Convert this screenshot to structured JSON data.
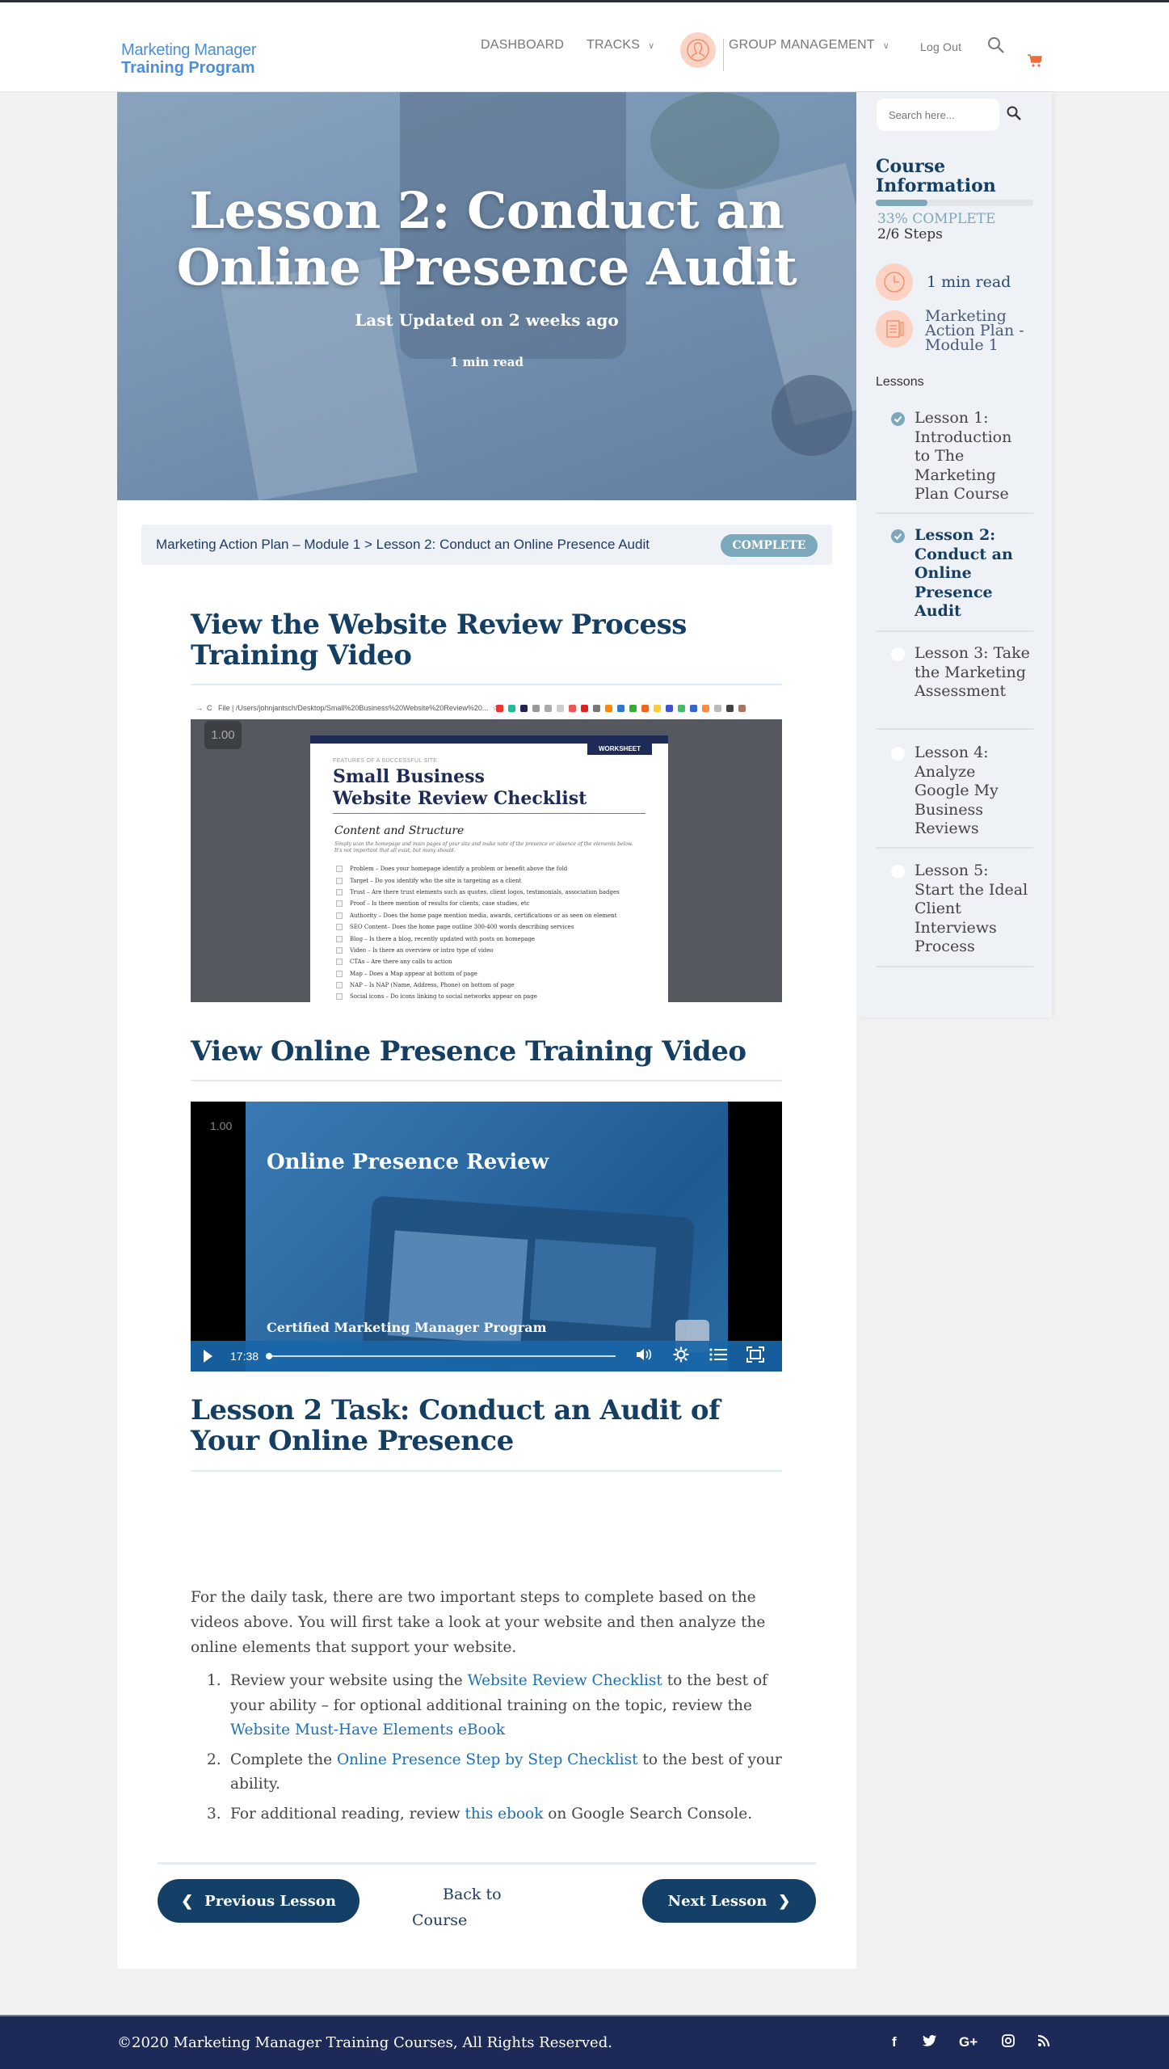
{
  "header": {
    "logo_line1": "Marketing Manager",
    "logo_line2": "Training Program",
    "nav": [
      {
        "label": "DASHBOARD"
      },
      {
        "label": "TRACKS"
      },
      {
        "label": "GROUP MANAGEMENT"
      },
      {
        "label": "Log Out"
      }
    ],
    "chevron": "⌄",
    "icons": {
      "user": "user-avatar-icon",
      "search": "search-icon",
      "cart": "cart-icon"
    },
    "accent_color": "#f06a3c"
  },
  "hero": {
    "title": "Lesson 2: Conduct an Online Presence Audit",
    "updated": "Last Updated on 2 weeks ago",
    "read_time": "1 min read"
  },
  "breadcrumb": {
    "text": "Marketing Action Plan – Module 1 > Lesson 2: Conduct an Online Presence Audit",
    "status": "COMPLETE"
  },
  "sections": {
    "video1_title": "View the Website Review Process Training Video",
    "video2_title": "View Online Presence Training Video",
    "task_title": "Lesson 2 Task: Conduct an Audit of Your Online Presence"
  },
  "video1": {
    "speed": "1.00",
    "browser_url": "File | /Users/johnjantsch/Desktop/Small%20Business%20Website%20Review%20...",
    "doc": {
      "badge": "WORKSHEET",
      "eyebrow": "FEATURES OF A SUCCESSFUL SITE",
      "title_line1": "Small Business",
      "title_line2": "Website Review Checklist",
      "section": "Content and Structure",
      "desc": "Simply scan the homepage and main pages of your site and make note of the presence or absence of the elements below. It's not important that all exist, but many should.",
      "items": [
        "Problem – Does your homepage identify a problem or benefit above the fold",
        "Target – Do you identify who the site is targeting as a client",
        "Trust – Are there trust elements such as quotes, client logos, testimonials, association badges",
        "Proof – Is there mention of results for clients, case studies, etc",
        "Authority – Does the home page mention media, awards, certifications or as seen on element",
        "SEO Content– Does the home page outline 300-400 words describing services",
        "Blog – Is there a blog, recently updated with posts on homepage",
        "Video – Is there an overview or intro type of video",
        "CTAs – Are there any calls to action",
        "Map – Does a Map appear at bottom of page",
        "NAP – Is NAP (Name, Address, Phone) on bottom of page",
        "Social icons – Do icons linking to social networks appear on page"
      ]
    }
  },
  "video2": {
    "speed": "1.00",
    "title": "Online Presence Review",
    "subtitle": "Certified Marketing Manager Program",
    "duration": "17:38",
    "progress": 0,
    "controls": {
      "play": "play-icon",
      "volume": "volume-icon",
      "settings": "settings-icon",
      "chapters": "chapters-icon",
      "fullscreen": "fullscreen-icon"
    }
  },
  "task": {
    "intro": "For the daily task, there are two important steps to complete based on the videos above.  You will first take a look at your website and then analyze the online elements that support your website.",
    "items": [
      {
        "num": "1.",
        "before": "Review your website using the ",
        "link1": "Website Review Checklist",
        "middle": " to the best of your ability – for optional additional training on the topic, review the ",
        "link2": "Website Must-Have Elements eBook",
        "after": ""
      },
      {
        "num": "2.",
        "before": "Complete the ",
        "link1": "Online Presence Step by Step Checklist",
        "middle": " to the best of your ability.",
        "link2": "",
        "after": ""
      },
      {
        "num": "3.",
        "before": "For additional reading, review ",
        "link1": "this ebook",
        "middle": " on Google Search Console.",
        "link2": "",
        "after": ""
      }
    ]
  },
  "lesson_nav": {
    "previous": "Previous Lesson",
    "back_line1": "Back to",
    "back_line2": "Course",
    "next": "Next Lesson"
  },
  "sidebar": {
    "search_placeholder": "Search here...",
    "course_info_title_1": "Course",
    "course_info_title_2": "Information",
    "progress_percent": 33,
    "progress_label": "33% COMPLETE",
    "steps": "2/6 Steps",
    "read_time": "1 min read",
    "module_1": "Marketing",
    "module_2": "Action Plan -",
    "module_3": "Module 1",
    "lessons_heading": "Lessons",
    "lessons": [
      {
        "label": "Lesson 1: Introduction to The Marketing Plan Course",
        "complete": true,
        "active": false
      },
      {
        "label": "Lesson 2: Conduct an Online Presence Audit",
        "complete": true,
        "active": true
      },
      {
        "label": "Lesson 3: Take the Marketing Assessment",
        "complete": false,
        "active": false
      },
      {
        "label": "Lesson 4: Analyze Google My Business Reviews",
        "complete": false,
        "active": false
      },
      {
        "label": "Lesson 5: Start the Ideal Client Interviews Process",
        "complete": false,
        "active": false
      }
    ]
  },
  "footer": {
    "copyright": "©2020 Marketing Manager Training Courses, All Rights Reserved.",
    "social": [
      {
        "name": "facebook-icon",
        "glyph": "f"
      },
      {
        "name": "twitter-icon",
        "glyph": "🐦"
      },
      {
        "name": "google-plus-icon",
        "glyph": "G+"
      },
      {
        "name": "instagram-icon",
        "glyph": "◎"
      },
      {
        "name": "rss-icon",
        "glyph": "))"
      }
    ]
  }
}
